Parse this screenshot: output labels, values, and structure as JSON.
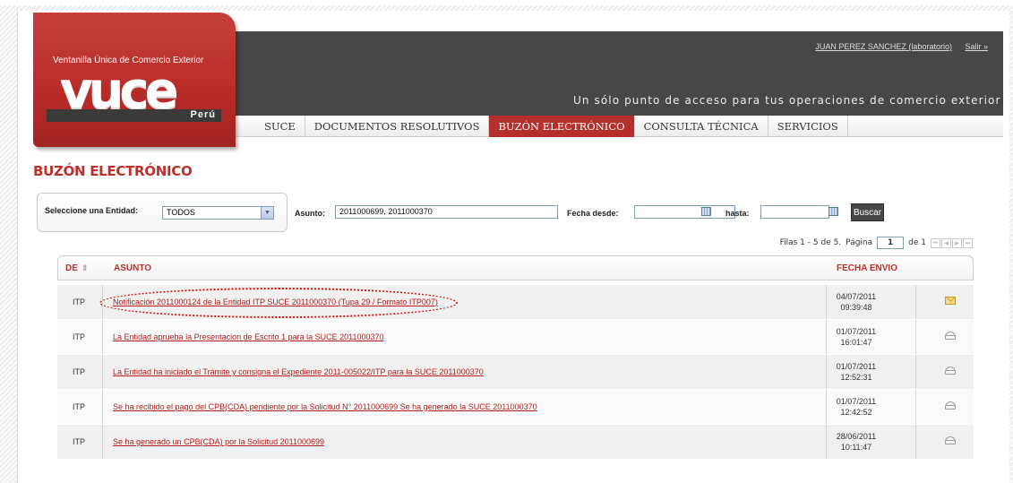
{
  "header": {
    "user_link": "JUAN PEREZ SANCHEZ (laboratorio)",
    "logout_link": "Salir »",
    "slogan": "Un sólo punto de acceso para tus operaciones de comercio exterior"
  },
  "logo": {
    "tagline": "Ventanilla Única de Comercio Exterior",
    "word": "vuce",
    "country": "Perú"
  },
  "nav": {
    "items": [
      "SUCE",
      "DOCUMENTOS RESOLUTIVOS",
      "BUZÓN ELECTRÓNICO",
      "CONSULTA TÉCNICA",
      "SERVICIOS"
    ],
    "active_index": 2
  },
  "page_title": "BUZÓN ELECTRÓNICO",
  "filters": {
    "entity_label": "Seleccione una Entidad:",
    "entity_value": "TODOS",
    "asunto_label": "Asunto:",
    "asunto_value": "2011000699, 2011000370",
    "fecha_desde_label": "Fecha desde:",
    "fecha_desde_value": "",
    "hasta_label": "hasta:",
    "hasta_value": "",
    "search_button": "Buscar"
  },
  "pagination": {
    "rows_text": "Filas 1 - 5 de 5.",
    "page_label": "Página",
    "page_value": "1",
    "of_text": "de 1"
  },
  "table": {
    "columns": {
      "de": "DE",
      "asunto": "ASUNTO",
      "fecha": "FECHA ENVIO"
    },
    "rows": [
      {
        "de": "ITP",
        "asunto": "Notificación 2011000124 de la Entidad ITP SUCE 2011000370 (Tupa 29 / Formato ITP007)",
        "date": "04/07/2011",
        "time": "09:39:48",
        "status_icon": "unread-mail-icon"
      },
      {
        "de": "ITP",
        "asunto": "La Entidad aprueba la Presentacion de Escrito 1 para la SUCE 2011000370",
        "date": "01/07/2011",
        "time": "16:01:47",
        "status_icon": "read-mail-icon"
      },
      {
        "de": "ITP",
        "asunto": "La Entidad ha iniciado el Trámite y consigna el Expediente 2011-005022/ITP para la SUCE 2011000370",
        "date": "01/07/2011",
        "time": "12:52:31",
        "status_icon": "read-mail-icon"
      },
      {
        "de": "ITP",
        "asunto": "Se ha recibido el pago del CPB(CDA) pendiente por la Solicitud N° 2011000699 Se ha generado la SUCE 2011000370",
        "date": "01/07/2011",
        "time": "12:42:52",
        "status_icon": "read-mail-icon"
      },
      {
        "de": "ITP",
        "asunto": "Se ha generado un CPB(CDA) por la Solicitud 2011000699",
        "date": "28/06/2011",
        "time": "10:11:47",
        "status_icon": "read-mail-icon"
      }
    ]
  },
  "colors": {
    "brand_red": "#b52f2d",
    "header_dark": "#4a4646",
    "link_red": "#b31d1d"
  }
}
